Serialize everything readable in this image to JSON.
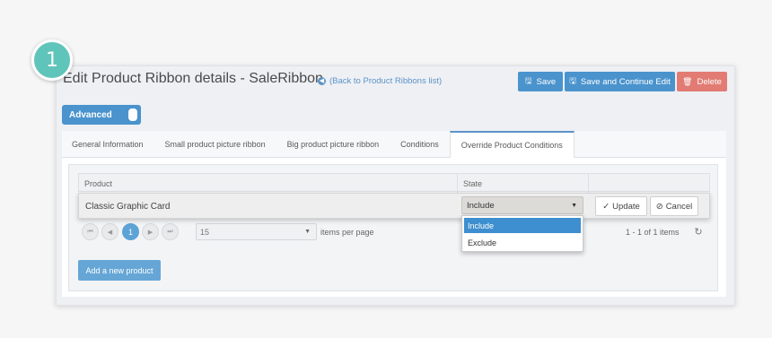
{
  "step": {
    "number": "1"
  },
  "header": {
    "title": "Edit Product Ribbon details - SaleRibbon",
    "back_link": "(Back to Product Ribbons list)",
    "save_label": "Save",
    "save_continue_label": "Save and Continue Edit",
    "delete_label": "Delete"
  },
  "advanced_toggle": {
    "label": "Advanced"
  },
  "tabs": [
    {
      "label": "General Information"
    },
    {
      "label": "Small product picture ribbon"
    },
    {
      "label": "Big product picture ribbon"
    },
    {
      "label": "Conditions"
    },
    {
      "label": "Override Product Conditions"
    }
  ],
  "grid": {
    "columns": {
      "product": "Product",
      "state": "State"
    },
    "edit_row": {
      "product": "Classic Graphic Card",
      "state": "Include",
      "update_label": "Update",
      "cancel_label": "Cancel"
    },
    "state_options": [
      "Include",
      "Exclude"
    ],
    "pager": {
      "current_page": "1",
      "page_size": "15",
      "per_page_label": "items per page",
      "info": "1 - 1 of 1 items"
    }
  },
  "add_button": {
    "label": "Add a new product"
  },
  "colors": {
    "primary": "#4a93cd",
    "danger": "#e27b73",
    "step_badge": "#5fc4ba",
    "selected_option": "#3d8fcf"
  }
}
